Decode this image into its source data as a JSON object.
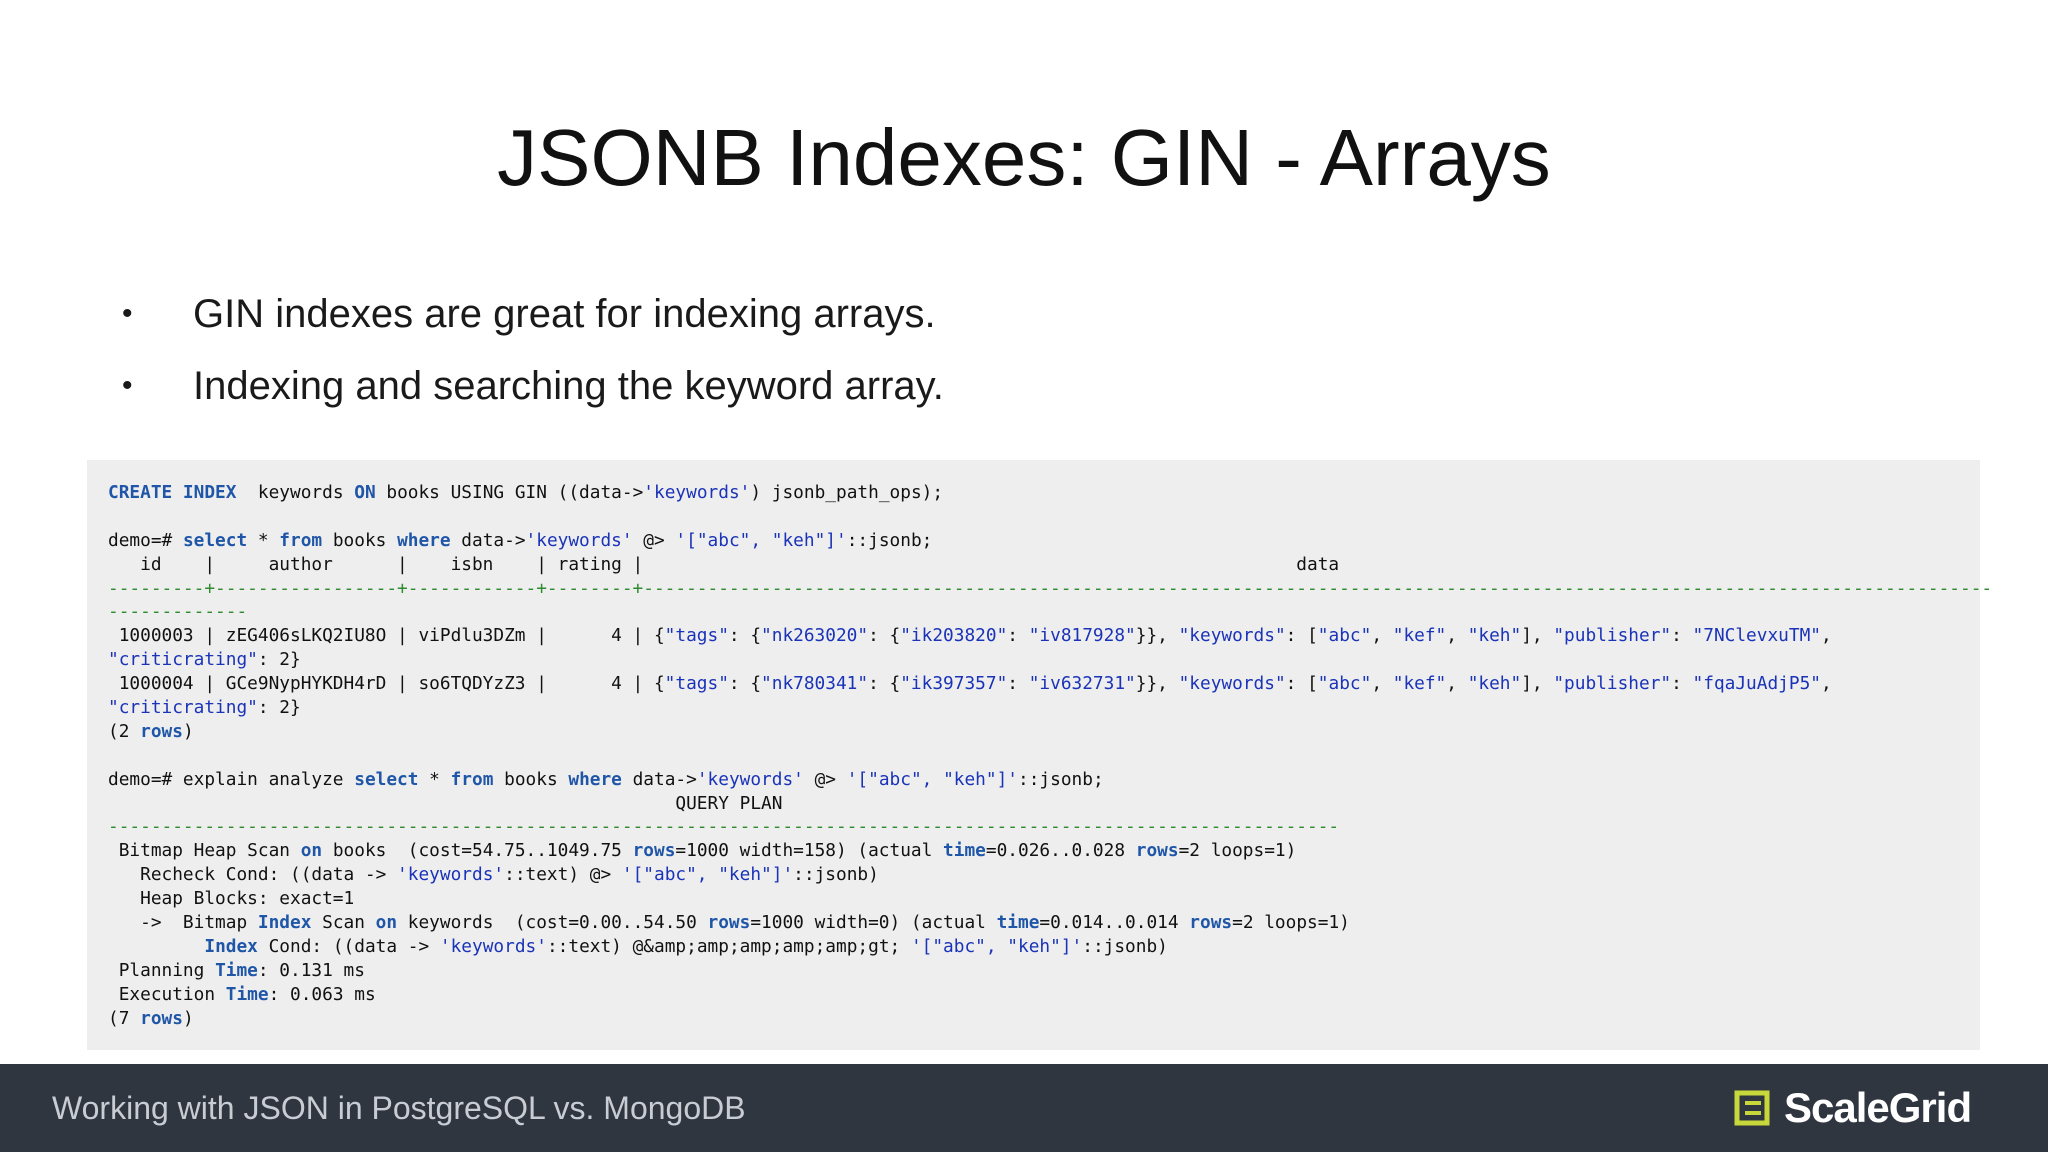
{
  "slide": {
    "title": "JSONB Indexes: GIN - Arrays",
    "bullets": [
      "GIN indexes are great for indexing arrays.",
      "Indexing and searching the keyword array."
    ]
  },
  "code": {
    "lines": [
      [
        [
          "kw",
          "CREATE INDEX"
        ],
        [
          "",
          "  keywords "
        ],
        [
          "kw",
          "ON"
        ],
        [
          "",
          " books USING GIN ((data->"
        ],
        [
          "str",
          "'keywords'"
        ],
        [
          "",
          ") jsonb_path_ops);"
        ]
      ],
      [],
      [
        [
          "",
          "demo=# "
        ],
        [
          "kw",
          "select"
        ],
        [
          "",
          " * "
        ],
        [
          "kw",
          "from"
        ],
        [
          "",
          " books "
        ],
        [
          "kw",
          "where"
        ],
        [
          "",
          " data->"
        ],
        [
          "str",
          "'keywords'"
        ],
        [
          "",
          " @> "
        ],
        [
          "str",
          "'[\"abc\", \"keh\"]'"
        ],
        [
          "",
          "::jsonb;"
        ]
      ],
      [
        [
          "",
          "   id    |     author      |    isbn    | rating |                                                             data"
        ]
      ],
      [
        [
          "dash",
          "---------+-----------------+------------+--------+------------------------------------------------------------------------------------------------------------------------------"
        ]
      ],
      [
        [
          "dash",
          "-------------"
        ]
      ],
      [
        [
          "",
          " 1000003 | zEG406sLKQ2IU8O | viPdlu3DZm |      4 | {"
        ],
        [
          "str",
          "\"tags\""
        ],
        [
          "",
          ": {"
        ],
        [
          "str",
          "\"nk263020\""
        ],
        [
          "",
          ": {"
        ],
        [
          "str",
          "\"ik203820\""
        ],
        [
          "",
          ": "
        ],
        [
          "str",
          "\"iv817928\""
        ],
        [
          "",
          "}}, "
        ],
        [
          "str",
          "\"keywords\""
        ],
        [
          "",
          ": ["
        ],
        [
          "str",
          "\"abc\""
        ],
        [
          "",
          ", "
        ],
        [
          "str",
          "\"kef\""
        ],
        [
          "",
          ", "
        ],
        [
          "str",
          "\"keh\""
        ],
        [
          "",
          "], "
        ],
        [
          "str",
          "\"publisher\""
        ],
        [
          "",
          ": "
        ],
        [
          "str",
          "\"7NClevxuTM\""
        ],
        [
          "",
          ","
        ]
      ],
      [
        [
          "str",
          "\"criticrating\""
        ],
        [
          "",
          ": 2}"
        ]
      ],
      [
        [
          "",
          " 1000004 | GCe9NypHYKDH4rD | so6TQDYzZ3 |      4 | {"
        ],
        [
          "str",
          "\"tags\""
        ],
        [
          "",
          ": {"
        ],
        [
          "str",
          "\"nk780341\""
        ],
        [
          "",
          ": {"
        ],
        [
          "str",
          "\"ik397357\""
        ],
        [
          "",
          ": "
        ],
        [
          "str",
          "\"iv632731\""
        ],
        [
          "",
          "}}, "
        ],
        [
          "str",
          "\"keywords\""
        ],
        [
          "",
          ": ["
        ],
        [
          "str",
          "\"abc\""
        ],
        [
          "",
          ", "
        ],
        [
          "str",
          "\"kef\""
        ],
        [
          "",
          ", "
        ],
        [
          "str",
          "\"keh\""
        ],
        [
          "",
          "], "
        ],
        [
          "str",
          "\"publisher\""
        ],
        [
          "",
          ": "
        ],
        [
          "str",
          "\"fqaJuAdjP5\""
        ],
        [
          "",
          ","
        ]
      ],
      [
        [
          "str",
          "\"criticrating\""
        ],
        [
          "",
          ": 2}"
        ]
      ],
      [
        [
          "",
          "(2 "
        ],
        [
          "kw",
          "rows"
        ],
        [
          "",
          ")"
        ]
      ],
      [],
      [
        [
          "",
          "demo=# explain analyze "
        ],
        [
          "kw",
          "select"
        ],
        [
          "",
          " * "
        ],
        [
          "kw",
          "from"
        ],
        [
          "",
          " books "
        ],
        [
          "kw",
          "where"
        ],
        [
          "",
          " data->"
        ],
        [
          "str",
          "'keywords'"
        ],
        [
          "",
          " @> "
        ],
        [
          "str",
          "'[\"abc\", \"keh\"]'"
        ],
        [
          "",
          "::jsonb;"
        ]
      ],
      [
        [
          "",
          "                                                     QUERY PLAN"
        ]
      ],
      [
        [
          "dash",
          "-------------------------------------------------------------------------------------------------------------------"
        ]
      ],
      [
        [
          "",
          " Bitmap Heap Scan "
        ],
        [
          "kw",
          "on"
        ],
        [
          "",
          " books  (cost=54.75..1049.75 "
        ],
        [
          "kw",
          "rows"
        ],
        [
          "",
          "=1000 width=158) (actual "
        ],
        [
          "kw",
          "time"
        ],
        [
          "",
          "=0.026..0.028 "
        ],
        [
          "kw",
          "rows"
        ],
        [
          "",
          "=2 loops=1)"
        ]
      ],
      [
        [
          "",
          "   Recheck Cond: ((data -> "
        ],
        [
          "str",
          "'keywords'"
        ],
        [
          "",
          "::text) @> "
        ],
        [
          "str",
          "'[\"abc\", \"keh\"]'"
        ],
        [
          "",
          "::jsonb)"
        ]
      ],
      [
        [
          "",
          "   Heap Blocks: exact=1"
        ]
      ],
      [
        [
          "",
          "   ->  Bitmap "
        ],
        [
          "kw",
          "Index"
        ],
        [
          "",
          " Scan "
        ],
        [
          "kw",
          "on"
        ],
        [
          "",
          " keywords  (cost=0.00..54.50 "
        ],
        [
          "kw",
          "rows"
        ],
        [
          "",
          "=1000 width=0) (actual "
        ],
        [
          "kw",
          "time"
        ],
        [
          "",
          "=0.014..0.014 "
        ],
        [
          "kw",
          "rows"
        ],
        [
          "",
          "=2 loops=1)"
        ]
      ],
      [
        [
          "",
          "         "
        ],
        [
          "kw",
          "Index"
        ],
        [
          "",
          " Cond: ((data -> "
        ],
        [
          "str",
          "'keywords'"
        ],
        [
          "",
          "::text) @&amp;amp;amp;amp;amp;gt; "
        ],
        [
          "str",
          "'[\"abc\", \"keh\"]'"
        ],
        [
          "",
          "::jsonb)"
        ]
      ],
      [
        [
          "",
          " Planning "
        ],
        [
          "kw",
          "Time"
        ],
        [
          "",
          ": 0.131 ms"
        ]
      ],
      [
        [
          "",
          " Execution "
        ],
        [
          "kw",
          "Time"
        ],
        [
          "",
          ": 0.063 ms"
        ]
      ],
      [
        [
          "",
          "(7 "
        ],
        [
          "kw",
          "rows"
        ],
        [
          "",
          ")"
        ]
      ]
    ]
  },
  "footer": {
    "text": "Working with JSON in PostgreSQL vs. MongoDB",
    "logo_text": "ScaleGrid",
    "logo_color": "#c8d83a"
  },
  "colors": {
    "keyword": "#1f56a8",
    "string": "#1a33b8",
    "dashes": "#2e8b2e",
    "panel": "#eeeeee",
    "footer_bg": "#2f3640"
  }
}
